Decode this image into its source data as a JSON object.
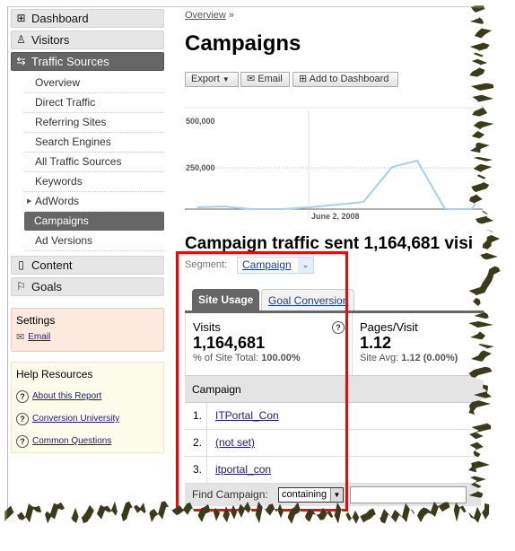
{
  "sidebar": {
    "sections": [
      {
        "label": "Dashboard",
        "icon": "grid-icon"
      },
      {
        "label": "Visitors",
        "icon": "person-icon"
      },
      {
        "label": "Traffic Sources",
        "icon": "arrows-icon",
        "active": true
      },
      {
        "label": "Content",
        "icon": "page-icon"
      },
      {
        "label": "Goals",
        "icon": "flag-icon"
      }
    ],
    "sub_items": [
      {
        "label": "Overview"
      },
      {
        "label": "Direct Traffic"
      },
      {
        "label": "Referring Sites"
      },
      {
        "label": "Search Engines"
      },
      {
        "label": "All Traffic Sources"
      },
      {
        "label": "Keywords"
      },
      {
        "label": "AdWords",
        "expandable": true
      },
      {
        "label": "Campaigns",
        "active": true
      },
      {
        "label": "Ad Versions"
      }
    ],
    "settings": {
      "title": "Settings",
      "email": "Email"
    },
    "help": {
      "title": "Help Resources",
      "links": [
        "About this Report",
        "Conversion University",
        "Common Questions"
      ]
    }
  },
  "main": {
    "breadcrumb": "Overview",
    "breadcrumb_sep": "»",
    "title": "Campaigns",
    "toolbar": {
      "export": "Export",
      "email": "Email",
      "add_dashboard": "Add to Dashboard"
    },
    "summary": "Campaign traffic sent 1,164,681 visi",
    "segment_label": "Segment:",
    "segment_value": "Campaign",
    "tabs": [
      "Site Usage",
      "Goal Conversion"
    ],
    "metrics": [
      {
        "label": "Visits",
        "value": "1,164,681",
        "sub_label": "% of Site Total:",
        "sub_value": "100.00%"
      },
      {
        "label": "Pages/Visit",
        "value": "1.12",
        "sub_label": "Site Avg:",
        "sub_value": "1.12 (0.00%)"
      }
    ],
    "table": {
      "header": "Campaign",
      "rows": [
        {
          "n": "1.",
          "name": "ITPortal_Con"
        },
        {
          "n": "2.",
          "name": "(not set)"
        },
        {
          "n": "3.",
          "name": "itportal_con"
        }
      ]
    },
    "find": {
      "label": "Find Campaign:",
      "mode": "containing",
      "value": ""
    }
  },
  "chart_data": {
    "type": "line",
    "y_ticks": [
      "500,000",
      "250,000"
    ],
    "x_label_tick": "June 2, 2008",
    "ylim": [
      0,
      500000
    ],
    "values": [
      11000,
      16000,
      0,
      0,
      11000,
      43000,
      255000,
      293000,
      0,
      0,
      81000
    ],
    "color": "#a8cfee"
  },
  "highlight_color": "#ff0000"
}
